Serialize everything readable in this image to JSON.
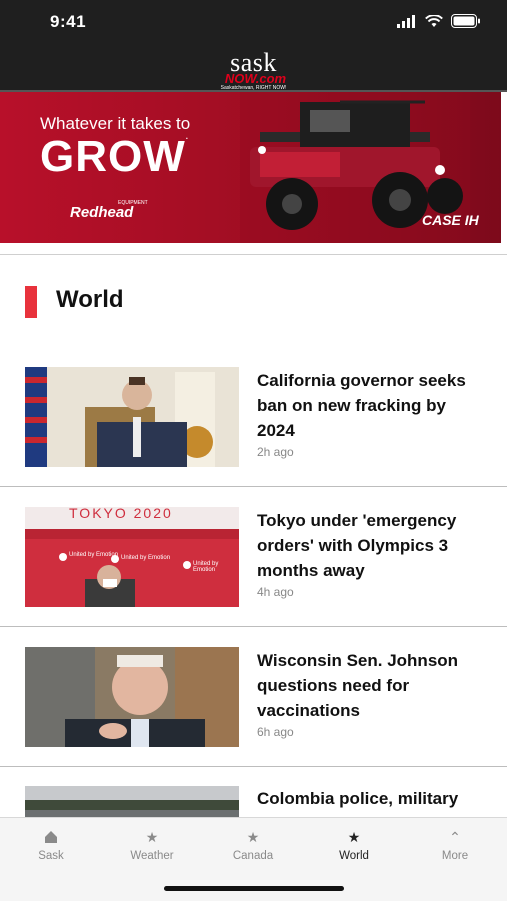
{
  "status_bar": {
    "time": "9:41"
  },
  "header": {
    "logo_word": "sask",
    "logo_now": "NOW.com",
    "logo_tagline": "Saskatchewan, RIGHT NOW!"
  },
  "ad": {
    "headline": "Whatever it takes to",
    "big_word": "GROW",
    "reg_mark": ".",
    "brand_left": "Redhead",
    "brand_left_small": "EQUIPMENT",
    "brand_right": "CASE IH"
  },
  "section": {
    "title": "World"
  },
  "articles": [
    {
      "title": "California governor seeks ban on new fracking by 2024",
      "time": "2h ago"
    },
    {
      "title": "Tokyo under 'emergency orders' with Olympics 3 months away",
      "time": "4h ago"
    },
    {
      "title": "Wisconsin Sen. Johnson questions need for vaccinations",
      "time": "6h ago"
    },
    {
      "title": "Colombia police, military",
      "time": ""
    }
  ],
  "thumb_text": {
    "tokyo_banner": "TOKYO 2020",
    "tokyo_sign": "United by Emotion"
  },
  "tabs": [
    {
      "label": "Sask",
      "icon": "home-icon"
    },
    {
      "label": "Weather",
      "icon": "star-icon"
    },
    {
      "label": "Canada",
      "icon": "star-icon"
    },
    {
      "label": "World",
      "icon": "star-icon",
      "active": true
    },
    {
      "label": "More",
      "icon": "chevron-up-icon"
    }
  ],
  "colors": {
    "accent": "#e8323c",
    "ad_red": "#b8102a",
    "header_bg": "#1f1f1f"
  }
}
